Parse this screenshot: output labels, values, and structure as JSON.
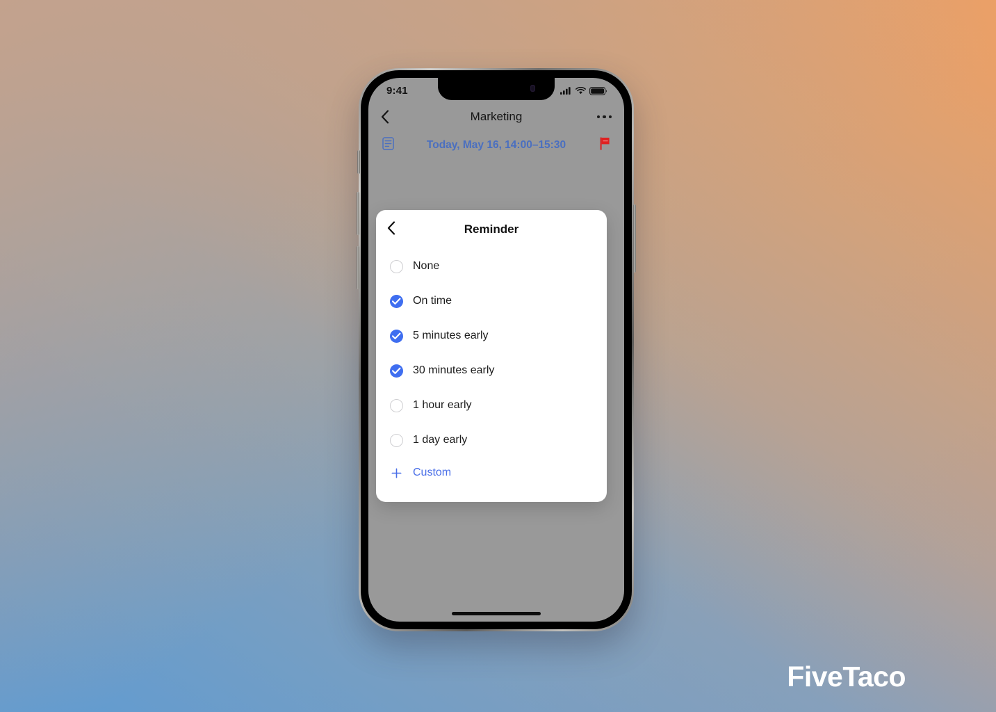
{
  "background": {
    "colors": {
      "top_left": "#c3a28d",
      "top_right": "#efa063",
      "bottom_left": "#5e9bd3",
      "bottom_right": "#94a1b5"
    }
  },
  "watermark": {
    "text": "FiveTaco"
  },
  "phone": {
    "status_bar": {
      "time": "9:41",
      "icons": [
        "signal-icon",
        "wifi-icon",
        "battery-icon"
      ]
    },
    "nav": {
      "back_icon": "chevron-left-icon",
      "title": "Marketing",
      "more_icon": "more-horizontal-icon"
    },
    "subheader": {
      "left_icon": "document-list-icon",
      "date": "Today, May 16, 14:00–15:30",
      "right_icon": "flag-icon",
      "date_color": "#4a6fc0",
      "flag_color": "#e02020"
    }
  },
  "sheet": {
    "back_icon": "chevron-left-icon",
    "title": "Reminder",
    "accent_color": "#3f6ef0",
    "options": [
      {
        "label": "None",
        "checked": false
      },
      {
        "label": "On time",
        "checked": true
      },
      {
        "label": "5 minutes early",
        "checked": true
      },
      {
        "label": "30 minutes early",
        "checked": true
      },
      {
        "label": "1 hour early",
        "checked": false
      },
      {
        "label": "1 day early",
        "checked": false
      }
    ],
    "custom": {
      "icon": "plus-icon",
      "label": "Custom",
      "color": "#4a6fe8"
    }
  }
}
